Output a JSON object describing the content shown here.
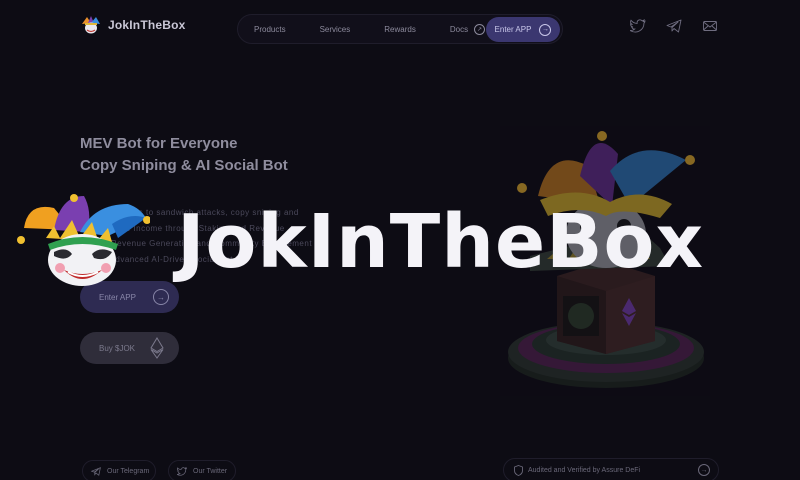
{
  "header": {
    "brand_name": "JokInTheBox",
    "nav": [
      {
        "label": "Products",
        "icon": ""
      },
      {
        "label": "Services",
        "icon": ""
      },
      {
        "label": "Rewards",
        "icon": ""
      },
      {
        "label": "Docs",
        "icon": "external-link-icon"
      }
    ],
    "enter_app_label": "Enter APP",
    "socials": [
      "twitter-icon",
      "telegram-icon",
      "mail-icon"
    ]
  },
  "hero": {
    "title_line1": "MEV Bot for Everyone",
    "title_line2": "Copy Sniping & AI Social Bot",
    "description_line1": "te access to sandwich attacks, copy sniping and",
    "description_line2": "assive Income through Staking and Revenue",
    "description_line3": "r Revenue Generation and Community Engagement",
    "description_line4": "l Advanced AI-Driven Social Bot \".",
    "enter_button": "Enter APP",
    "buy_button": "Buy $JOK"
  },
  "overlay": {
    "title": "JokInTheBox"
  },
  "footer": {
    "telegram": "Our Telegram",
    "twitter": "Our Twitter",
    "audit": "Audited and Verified by Assure DeFi"
  },
  "colors": {
    "background": "#0d0c14",
    "accent": "#3b3770",
    "jester_orange": "#f0a020",
    "jester_purple": "#7a3fb0",
    "jester_blue": "#3a8fe0"
  }
}
